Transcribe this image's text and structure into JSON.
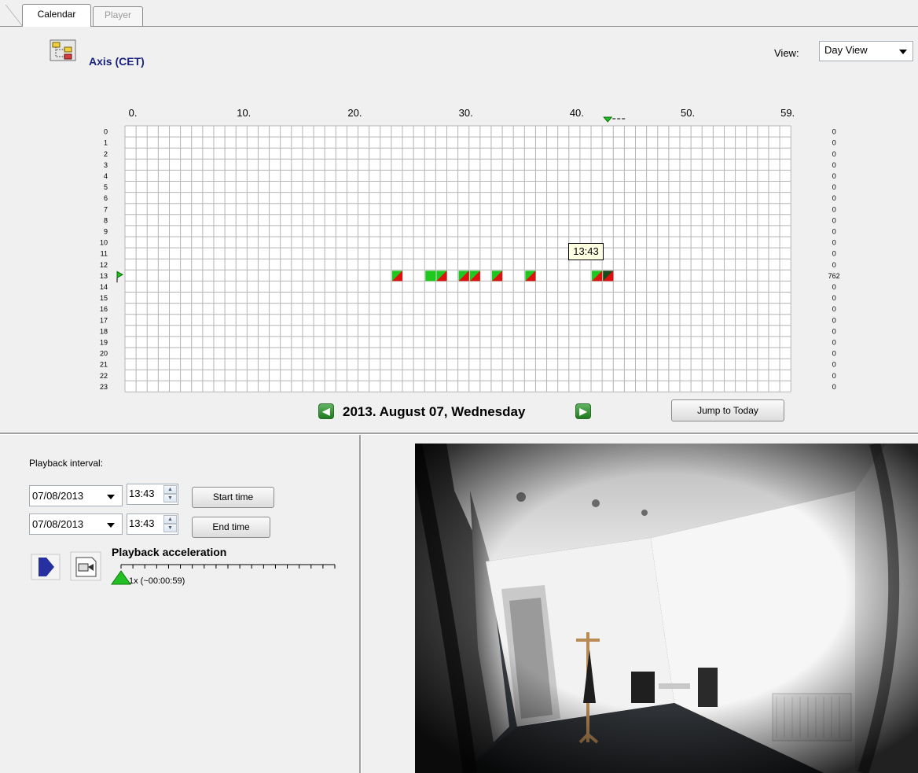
{
  "tabs": [
    {
      "label": "Calendar",
      "active": true
    },
    {
      "label": "Player",
      "active": false
    }
  ],
  "camera": {
    "name": "Axis (CET)",
    "icon": "camera-tree-icon"
  },
  "view": {
    "label": "View:",
    "selected": "Day View"
  },
  "grid": {
    "minute_ticks": [
      {
        "label": "0.",
        "minute": 0
      },
      {
        "label": "10.",
        "minute": 10
      },
      {
        "label": "20.",
        "minute": 20
      },
      {
        "label": "30.",
        "minute": 30
      },
      {
        "label": "40.",
        "minute": 40
      },
      {
        "label": "50.",
        "minute": 50
      },
      {
        "label": "59.",
        "minute": 59
      }
    ],
    "hours": [
      "0",
      "1",
      "2",
      "3",
      "4",
      "5",
      "6",
      "7",
      "8",
      "9",
      "10",
      "11",
      "12",
      "13",
      "14",
      "15",
      "16",
      "17",
      "18",
      "19",
      "20",
      "21",
      "22",
      "23"
    ],
    "hour_counts": [
      "0",
      "0",
      "0",
      "0",
      "0",
      "0",
      "0",
      "0",
      "0",
      "0",
      "0",
      "0",
      "0",
      "762",
      "0",
      "0",
      "0",
      "0",
      "0",
      "0",
      "0",
      "0",
      "0",
      "0"
    ],
    "recordings": [
      {
        "hour": 13,
        "minute": 24,
        "type": "half"
      },
      {
        "hour": 13,
        "minute": 27,
        "type": "full"
      },
      {
        "hour": 13,
        "minute": 28,
        "type": "half"
      },
      {
        "hour": 13,
        "minute": 30,
        "type": "half"
      },
      {
        "hour": 13,
        "minute": 31,
        "type": "half"
      },
      {
        "hour": 13,
        "minute": 33,
        "type": "half"
      },
      {
        "hour": 13,
        "minute": 36,
        "type": "half"
      },
      {
        "hour": 13,
        "minute": 42,
        "type": "half"
      },
      {
        "hour": 13,
        "minute": 43,
        "type": "selected"
      }
    ],
    "current_hour": 13,
    "current_minute": 43,
    "tooltip": "13:43",
    "colors": {
      "recorded": "#1ec81e",
      "motion": "#e01010",
      "selected": "#1a4a1a"
    }
  },
  "date_nav": {
    "date": "2013. August 07, Wednesday",
    "prev_icon": "prev-arrow-icon",
    "next_icon": "next-arrow-icon"
  },
  "jump_today": "Jump to Today",
  "playback": {
    "label": "Playback interval:",
    "start_date": "07/08/2013",
    "start_time": "13:43",
    "start_button": "Start time",
    "end_date": "07/08/2013",
    "end_time": "13:43",
    "end_button": "End time",
    "accel_label": "Playback acceleration",
    "accel_value": "1x (~00:00:59)",
    "accel_level": 0
  }
}
